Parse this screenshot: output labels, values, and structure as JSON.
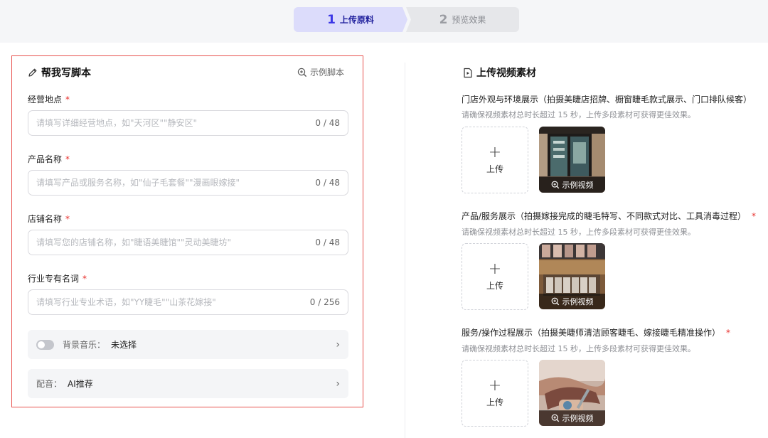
{
  "steps": [
    {
      "num": "1",
      "label": "上传原料"
    },
    {
      "num": "2",
      "label": "预览效果"
    }
  ],
  "script_panel": {
    "title": "帮我写脚本",
    "example_link": "示例脚本",
    "fields": [
      {
        "label": "经营地点",
        "placeholder": "请填写详细经营地点，如\"天河区\"\"静安区\"",
        "value": "",
        "counter": "0 / 48"
      },
      {
        "label": "产品名称",
        "placeholder": "请填写产品或服务名称，如\"仙子毛套餐\"\"漫画眼嫁接\"",
        "value": "",
        "counter": "0 / 48"
      },
      {
        "label": "店铺名称",
        "placeholder": "请填写您的店铺名称，如\"睫语美睫馆\"\"灵动美睫坊\"",
        "value": "",
        "counter": "0 / 48"
      },
      {
        "label": "行业专有名词",
        "placeholder": "请填写行业专业术语，如\"YY睫毛\"\"山茶花嫁接\"",
        "value": "",
        "counter": "0 / 256"
      }
    ],
    "required_mark": "*",
    "music": {
      "key": "背景音乐：",
      "value": "未选择"
    },
    "voice": {
      "key": "配音：",
      "value": "AI推荐"
    },
    "chevron": "›"
  },
  "upload_panel": {
    "title": "上传视频素材",
    "upload_label": "上传",
    "plus": "+",
    "example_video": "示例视频",
    "sections": [
      {
        "title": "门店外观与环境展示（拍摄美睫店招牌、橱窗睫毛款式展示、门口排队候客）",
        "required": "",
        "hint": "请确保视频素材总时长超过 15 秒，上传多段素材可获得更佳效果。"
      },
      {
        "title": "产品/服务展示（拍摄嫁接完成的睫毛特写、不同款式对比、工具消毒过程）",
        "required": "*",
        "hint": "请确保视频素材总时长超过 15 秒，上传多段素材可获得更佳效果。"
      },
      {
        "title": "服务/操作过程展示（拍摄美睫师清洁顾客睫毛、嫁接睫毛精准操作）",
        "required": "*",
        "hint": "请确保视频素材总时长超过 15 秒，上传多段素材可获得更佳效果。"
      }
    ]
  },
  "colors": {
    "accent": "#3b37e6",
    "required": "#e8302c",
    "highlight_border": "#e8524f"
  },
  "icons": [
    "pencil-icon",
    "zoom-in-icon",
    "video-file-icon",
    "plus-icon",
    "chevron-right-icon",
    "toggle-switch"
  ]
}
